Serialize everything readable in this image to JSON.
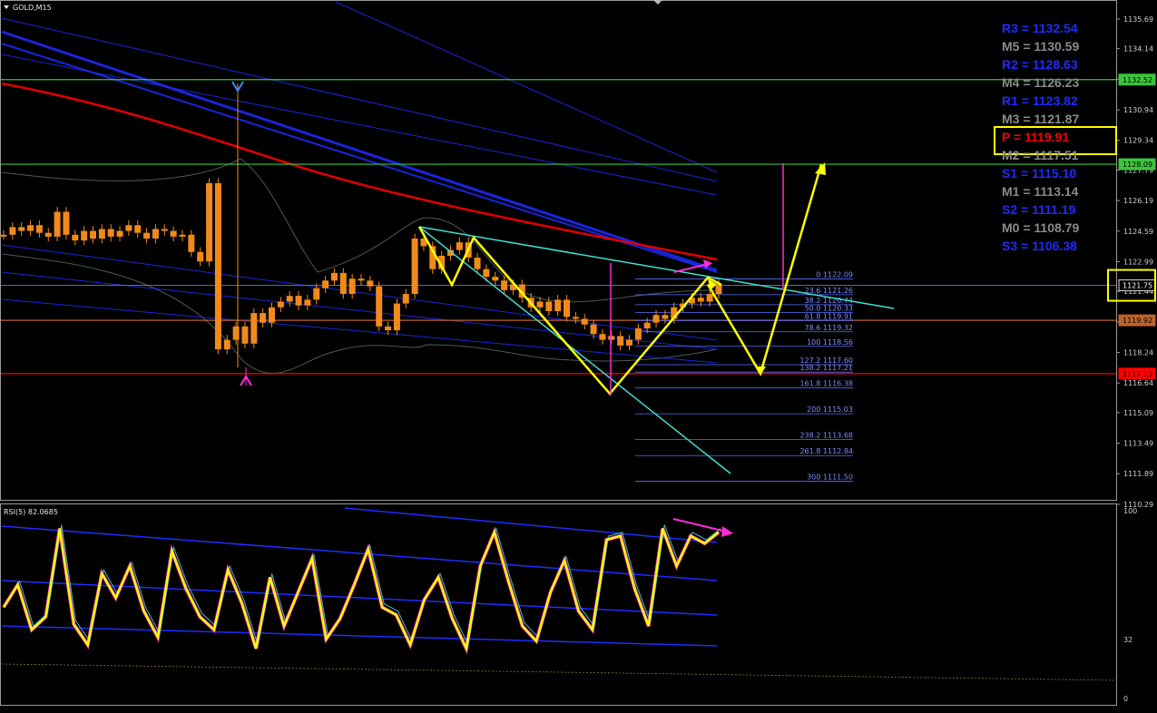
{
  "header": {
    "symbol": "GOLD,M15",
    "rsi_label": "RSI(5) 82.0685"
  },
  "colors": {
    "background": "#000000",
    "candle": "#f08a1c",
    "ma_red": "#e00000",
    "ma_blue": "#1e2cff",
    "level_green": "#3cc43c",
    "level_red": "#ff0000",
    "level_orange": "#c0622a",
    "zigzag": "#ffff00",
    "trend": "#40e0d0",
    "fib": "#5a6cff",
    "magenta": "#ff2bd6",
    "rsi_main": "#ffff00",
    "pivot_R": "#1e2cff",
    "pivot_M": "#8a8a8a",
    "pivot_P": "#ff0000"
  },
  "pivots": [
    {
      "label": "R3 = 1132.54",
      "kind": "R"
    },
    {
      "label": "M5 = 1130.59",
      "kind": "M"
    },
    {
      "label": "R2 = 1128.63",
      "kind": "R"
    },
    {
      "label": "M4 = 1126.23",
      "kind": "M"
    },
    {
      "label": "R1 = 1123.82",
      "kind": "R"
    },
    {
      "label": "M3 = 1121.87",
      "kind": "M"
    },
    {
      "label": "P  = 1119.91",
      "kind": "P"
    },
    {
      "label": "M2 = 1117.51",
      "kind": "M"
    },
    {
      "label": "S1 = 1115.10",
      "kind": "R"
    },
    {
      "label": "M1 = 1113.14",
      "kind": "M"
    },
    {
      "label": "S2 = 1111.19",
      "kind": "R"
    },
    {
      "label": "M0 = 1108.79",
      "kind": "M"
    },
    {
      "label": "S3 = 1106.38",
      "kind": "R"
    }
  ],
  "chart_data": {
    "type": "line",
    "title": "GOLD,M15",
    "ylim": [
      1110.0,
      1136.5
    ],
    "y_ticks": [
      "1135.69",
      "1134.14",
      "1132.54",
      "1130.94",
      "1129.34",
      "1127.79",
      "1126.19",
      "1124.59",
      "1122.99",
      "1121.44",
      "1119.84",
      "1118.24",
      "1116.64",
      "1115.09",
      "1113.49",
      "1111.89",
      "1110.29"
    ],
    "y_tick_values": [
      1135.69,
      1134.14,
      1132.54,
      1130.94,
      1129.34,
      1127.79,
      1126.19,
      1124.59,
      1122.99,
      1121.44,
      1119.84,
      1118.24,
      1116.64,
      1115.09,
      1113.49,
      1111.89,
      1110.29
    ],
    "price_badges": [
      {
        "text": "1132.52",
        "value": 1132.52,
        "color": "#3cc43c"
      },
      {
        "text": "1128.09",
        "value": 1128.09,
        "color": "#3cc43c"
      },
      {
        "text": "1121.75",
        "value": 1121.75,
        "color": "#000000"
      },
      {
        "text": "1119.92",
        "value": 1119.92,
        "color": "#c0622a"
      },
      {
        "text": "1117.13",
        "value": 1117.13,
        "color": "#ff0000"
      }
    ],
    "levels": [
      {
        "value": 1132.52,
        "color": "#3cc43c"
      },
      {
        "value": 1128.09,
        "color": "#3cc43c"
      },
      {
        "value": 1119.92,
        "color": "#c0622a"
      },
      {
        "value": 1117.13,
        "color": "#ff0000"
      },
      {
        "value": 1121.75,
        "color": "#6a7ab8"
      }
    ],
    "fib_levels": [
      {
        "label": "0 1122.09",
        "value": 1122.09
      },
      {
        "label": "23.6 1121.26",
        "value": 1121.26
      },
      {
        "label": "38.2 1120.74",
        "value": 1120.74
      },
      {
        "label": "50.0 1120.33",
        "value": 1120.33
      },
      {
        "label": "61.8 1119.91",
        "value": 1119.91
      },
      {
        "label": "78.6 1119.32",
        "value": 1119.32
      },
      {
        "label": "100 1118.56",
        "value": 1118.56
      },
      {
        "label": "127.2 1117.60",
        "value": 1117.6
      },
      {
        "label": "138.2 1117.21",
        "value": 1117.21
      },
      {
        "label": "161.8 1116.38",
        "value": 1116.38
      },
      {
        "label": "200 1115.03",
        "value": 1115.03
      },
      {
        "label": "238.2 1113.68",
        "value": 1113.68
      },
      {
        "label": "261.8 1112.84",
        "value": 1112.84
      },
      {
        "label": "300 1111.50",
        "value": 1111.5
      }
    ],
    "series": [
      {
        "values": [
          1124.4,
          1124.8,
          1124.6,
          1124.9,
          1124.5,
          1124.3,
          1125.6,
          1124.4,
          1124.1,
          1124.6,
          1124.2,
          1124.7,
          1124.3,
          1124.6,
          1124.9,
          1124.5,
          1124.2,
          1124.7,
          1124.6,
          1124.3,
          1124.4,
          1123.5,
          1123.0,
          1127.1,
          1118.4,
          1118.9,
          1119.6,
          1118.7,
          1120.3,
          1119.8,
          1120.6,
          1120.9,
          1121.2,
          1120.7,
          1121.0,
          1121.6,
          1122.0,
          1122.4,
          1121.3,
          1122.1,
          1122.0,
          1121.7,
          1119.6,
          1119.4,
          1120.8,
          1121.3,
          1124.2,
          1123.8,
          1122.6,
          1123.3,
          1123.6,
          1124.0,
          1123.2,
          1122.6,
          1122.2,
          1122.0,
          1121.5,
          1121.8,
          1121.1,
          1120.6,
          1120.9,
          1120.4,
          1121.0,
          1120.1,
          1120.0,
          1119.7,
          1119.2,
          1118.9,
          1119.1,
          1118.6,
          1118.9,
          1119.5,
          1119.8,
          1120.2,
          1120.0,
          1120.6,
          1120.8,
          1121.1,
          1120.9,
          1121.3,
          1121.8
        ]
      },
      {
        "values": [
          1125.3,
          1124.8,
          1124.2,
          1123.7,
          1123.2,
          1122.8,
          1122.5,
          1122.2,
          1121.9,
          1121.6
        ]
      },
      {
        "values": [
          50,
          62,
          38,
          45,
          92,
          41,
          30,
          68,
          55,
          72,
          48,
          34,
          80,
          60,
          45,
          38,
          70,
          52,
          28,
          66,
          40,
          58,
          76,
          33,
          44,
          62,
          81,
          50,
          46,
          30,
          54,
          66,
          44,
          28,
          72,
          90,
          64,
          40,
          32,
          58,
          75,
          48,
          38,
          86,
          88,
          60,
          40,
          92,
          72,
          88,
          84,
          90
        ]
      }
    ],
    "forecast": [
      1121.8,
      1117.13,
      1128.09
    ]
  }
}
